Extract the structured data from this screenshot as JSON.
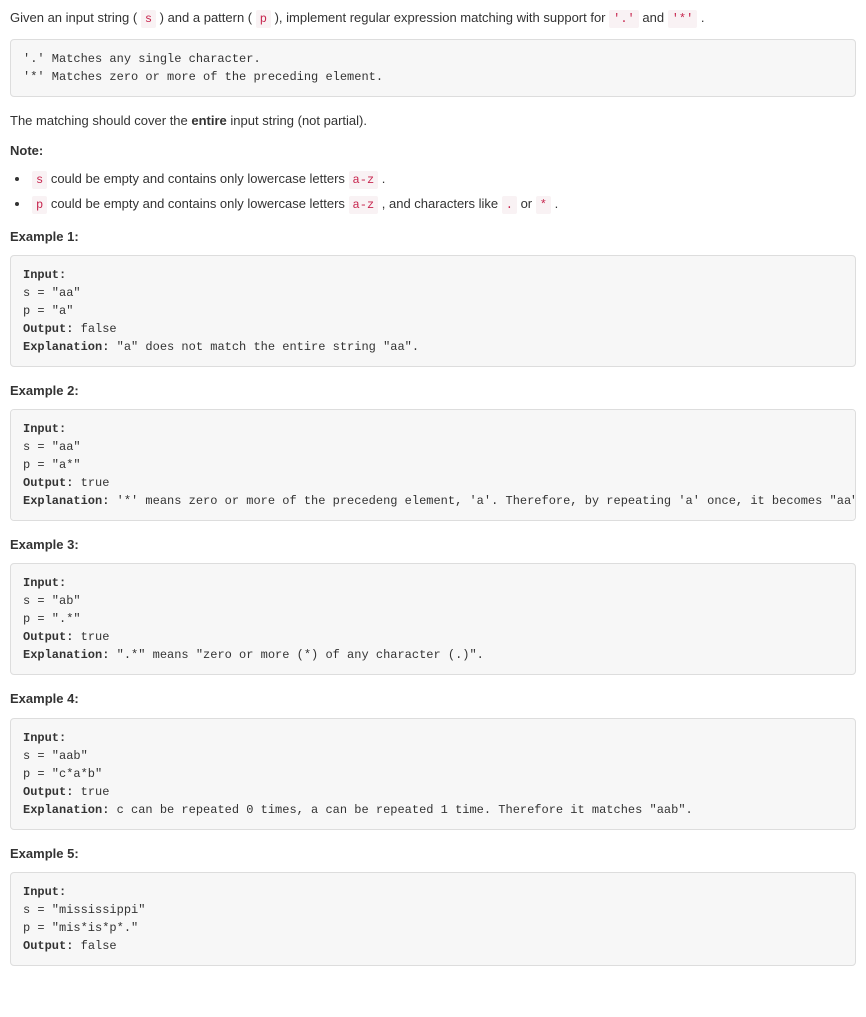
{
  "intro": {
    "t1": "Given an input string (",
    "c1": "s",
    "t2": ") and a pattern (",
    "c2": "p",
    "t3": "), implement regular expression matching with support for ",
    "c3": "'.'",
    "t4": " and ",
    "c4": "'*'",
    "t5": "."
  },
  "rules": "'.' Matches any single character.\n'*' Matches zero or more of the preceding element.",
  "cover": {
    "t1": "The matching should cover the ",
    "b1": "entire",
    "t2": " input string (not partial)."
  },
  "note_head": "Note:",
  "note1": {
    "c1": "s",
    "t1": " could be empty and contains only lowercase letters ",
    "c2": "a-z",
    "t2": "."
  },
  "note2": {
    "c1": "p",
    "t1": " could be empty and contains only lowercase letters ",
    "c2": "a-z",
    "t2": ", and characters like ",
    "c3": ".",
    "t3": " or ",
    "c4": "*",
    "t4": "."
  },
  "ex1_head": "Example 1:",
  "ex1": {
    "l1a": "Input:",
    "l2": "s = \"aa\"",
    "l3": "p = \"a\"",
    "l4a": "Output:",
    "l4b": " false",
    "l5a": "Explanation:",
    "l5b": " \"a\" does not match the entire string \"aa\"."
  },
  "ex2_head": "Example 2:",
  "ex2": {
    "l1a": "Input:",
    "l2": "s = \"aa\"",
    "l3": "p = \"a*\"",
    "l4a": "Output:",
    "l4b": " true",
    "l5a": "Explanation:",
    "l5b": " '*' means zero or more of the precedeng element, 'a'. Therefore, by repeating 'a' once, it becomes \"aa\"."
  },
  "ex3_head": "Example 3:",
  "ex3": {
    "l1a": "Input:",
    "l2": "s = \"ab\"",
    "l3": "p = \".*\"",
    "l4a": "Output:",
    "l4b": " true",
    "l5a": "Explanation:",
    "l5b": " \".*\" means \"zero or more (*) of any character (.)\"."
  },
  "ex4_head": "Example 4:",
  "ex4": {
    "l1a": "Input:",
    "l2": "s = \"aab\"",
    "l3": "p = \"c*a*b\"",
    "l4a": "Output:",
    "l4b": " true",
    "l5a": "Explanation:",
    "l5b": " c can be repeated 0 times, a can be repeated 1 time. Therefore it matches \"aab\"."
  },
  "ex5_head": "Example 5:",
  "ex5": {
    "l1a": "Input:",
    "l2": "s = \"mississippi\"",
    "l3": "p = \"mis*is*p*.\"",
    "l4a": "Output:",
    "l4b": " false"
  }
}
